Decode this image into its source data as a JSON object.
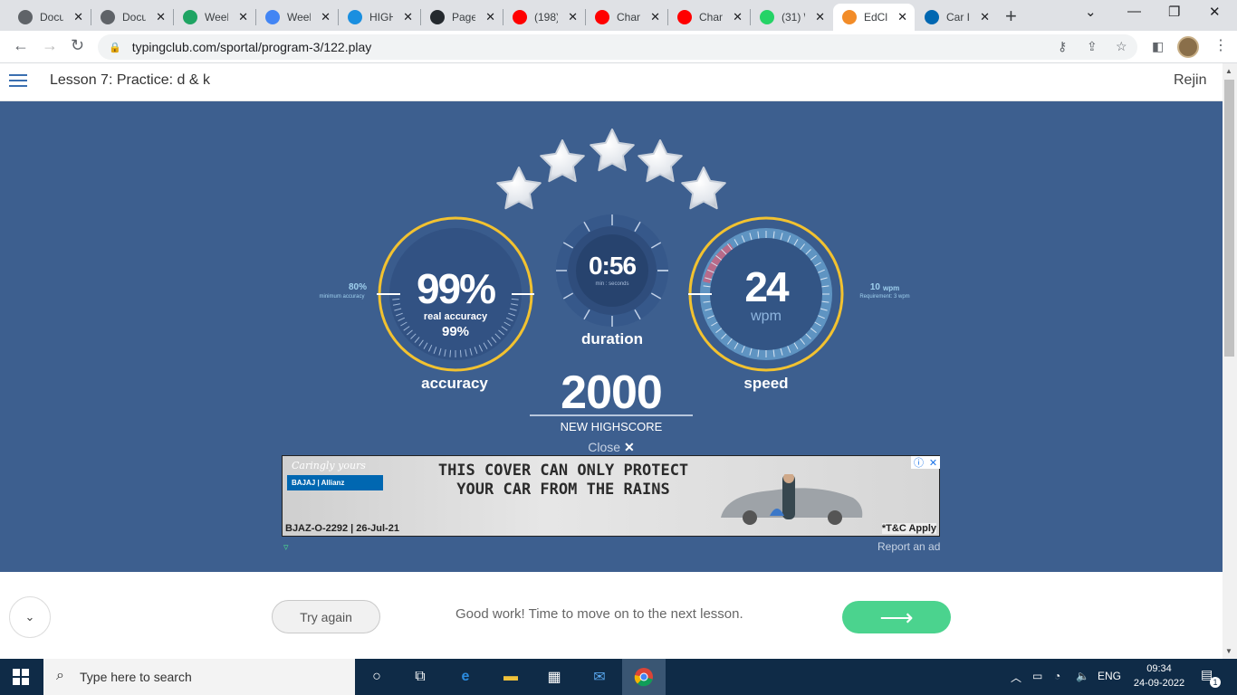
{
  "browser": {
    "tabs": [
      {
        "label": "Docu",
        "icon": "globe-icon",
        "color": "#5f6368"
      },
      {
        "label": "Docu",
        "icon": "globe-icon",
        "color": "#5f6368"
      },
      {
        "label": "Week",
        "icon": "google-drive-icon",
        "color": "#1fa463"
      },
      {
        "label": "Week",
        "icon": "google-docs-icon",
        "color": "#4285f4"
      },
      {
        "label": "HIGH",
        "icon": "ibb-icon",
        "color": "#1a8fe0"
      },
      {
        "label": "Page",
        "icon": "github-icon",
        "color": "#24292e"
      },
      {
        "label": "(198)",
        "icon": "youtube-icon",
        "color": "#ff0000"
      },
      {
        "label": "Chan",
        "icon": "youtube-icon",
        "color": "#ff0000"
      },
      {
        "label": "Chan",
        "icon": "youtube-icon",
        "color": "#ff0000"
      },
      {
        "label": "(31) \\",
        "icon": "whatsapp-icon",
        "color": "#25d366"
      },
      {
        "label": "EdCl",
        "icon": "edclub-icon",
        "color": "#f28c28"
      },
      {
        "label": "Car I",
        "icon": "bajaj-icon",
        "color": "#0067b1"
      }
    ],
    "active_tab": 10,
    "url": "typingclub.com/sportal/program-3/122.play"
  },
  "header": {
    "lesson_title": "Lesson 7: Practice: d & k",
    "user": "Rejin"
  },
  "results": {
    "stars": 5,
    "accuracy": {
      "value": "99%",
      "sub_label": "real accuracy",
      "sub_value": "99%",
      "label": "accuracy",
      "min_value": "80%",
      "min_label": "minimum accuracy"
    },
    "duration": {
      "value": "0:56",
      "unit": "min : seconds",
      "label": "duration"
    },
    "speed": {
      "value": "24",
      "unit": "wpm",
      "label": "speed",
      "req_value": "10",
      "req_unit": "wpm",
      "req_label": "Requirement: 3 wpm"
    },
    "score": "2000",
    "score_label": "NEW HIGHSCORE",
    "close_label": "Close"
  },
  "ad": {
    "tagline": "Caringly yours",
    "brand": "BAJAJ | Allianz",
    "headline_line1": "THIS COVER CAN ONLY PROTECT",
    "headline_line2": "YOUR CAR FROM THE RAINS",
    "code": "BJAZ-O-2292 | 26-Jul-21",
    "tnc": "*T&C Apply",
    "report": "Report an ad"
  },
  "footer": {
    "try_again": "Try again",
    "message": "Good work! Time to move on to the next lesson.",
    "next_arrow": "⟶"
  },
  "taskbar": {
    "search_placeholder": "Type here to search",
    "lang": "ENG",
    "time": "09:34",
    "date": "24-09-2022",
    "notifications": "1"
  },
  "colors": {
    "stage": "#3d5f8f",
    "gauge_ring": "#f2c230",
    "gauge_fill": "#325283",
    "next_button": "#4bd38e"
  }
}
